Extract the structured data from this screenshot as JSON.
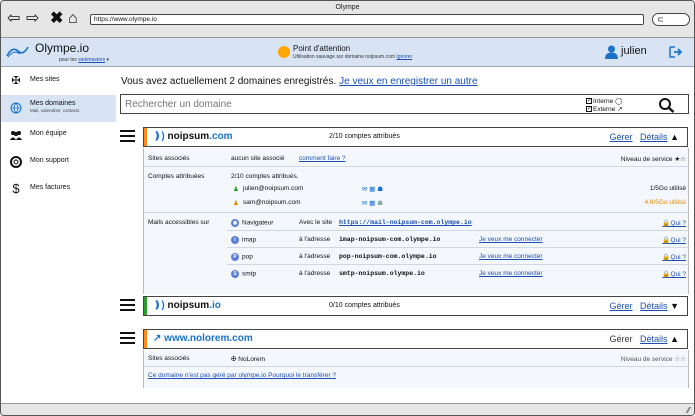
{
  "browser": {
    "title": "Olympe",
    "url": "https://www.olympe.io"
  },
  "header": {
    "app_name": "Olympe.io",
    "tagline_prefix": "pour les",
    "tagline_link": "webmasters",
    "alert_title": "Point d'attention",
    "alert_text": "Utilisation sauvage sur domaine noipsum.com",
    "alert_ignore": "Ignorer",
    "username": "julien"
  },
  "sidebar": {
    "items": [
      {
        "label": "Mes sites",
        "sub": "",
        "icon": "gear-icon"
      },
      {
        "label": "Mes domaines",
        "sub": "Mail, calendrier, contacts",
        "icon": "globe-icon"
      },
      {
        "label": "Mon équipe",
        "sub": "",
        "icon": "team-icon"
      },
      {
        "label": "Mon support",
        "sub": "",
        "icon": "lifebuoy-icon"
      },
      {
        "label": "Mes factures",
        "sub": "",
        "icon": "dollar-icon"
      }
    ]
  },
  "main": {
    "intro": "Vous avez actuellement 2 domaines enregistrés.",
    "intro_link": "Je veux en enregistrer un autre",
    "search_placeholder": "Rechercher un domaine",
    "filter_internal": "Interne",
    "filter_external": "Externe"
  },
  "domains": [
    {
      "name": "noipsum",
      "tld": ".com",
      "count": "2/10 comptes attribués",
      "manage": "Gérer",
      "details": "Détails",
      "accent": "#ff8c1a",
      "sites_label": "Sites associés",
      "sites_value": "aucun site associé",
      "sites_help": "comment faire ?",
      "service_label": "Niveau de service",
      "accounts_label": "Comptes attribuées",
      "accounts_summary": "2/10 comptes attribués.",
      "accounts": [
        {
          "email": "julien@noipsum.com",
          "usage": "1/5Go utilisé",
          "usage_color": "#111111"
        },
        {
          "email": "sam@noipsum.com",
          "usage": "4.6/5Go utilisé",
          "usage_color": "#e58a00"
        }
      ],
      "mail_label": "Mails accessibles sur",
      "mail_rows": [
        {
          "proto": "Navigateur",
          "prefix": "Avec le site",
          "address": "https://mail-noipsum-com.olympe.io",
          "connect": "",
          "qui": "Qui ?"
        },
        {
          "proto": "imap",
          "prefix": "à l'adresse",
          "address": "imap-noipsum-com.olympe.io",
          "connect": "Je veux me connecter",
          "qui": "Qui ?"
        },
        {
          "proto": "pop",
          "prefix": "à l'adresse",
          "address": "pop-noipsum-com.olympe.io",
          "connect": "Je veux me connecter",
          "qui": "Qui ?"
        },
        {
          "proto": "smtp",
          "prefix": "à l'adresse",
          "address": "smtp-noipsum.olympe.io",
          "connect": "Je veux me connecter",
          "qui": "Qui ?"
        }
      ]
    },
    {
      "name": "noipsum",
      "tld": ".io",
      "count": "0/10 comptes attribués",
      "manage": "Gérer",
      "details": "Détails",
      "accent": "#2a9d2a"
    },
    {
      "name": "www.nolorem",
      "tld": ".com",
      "manage": "Gérer",
      "details": "Détails",
      "accent": "#ff8c1a",
      "sites_label": "Sites associés",
      "sites_value": "NoLorem",
      "service_label": "Niveau de service",
      "transfer_text": "Ce domaine n'est pas géré par olympe.io Pourquoi le transférer ?"
    }
  ]
}
